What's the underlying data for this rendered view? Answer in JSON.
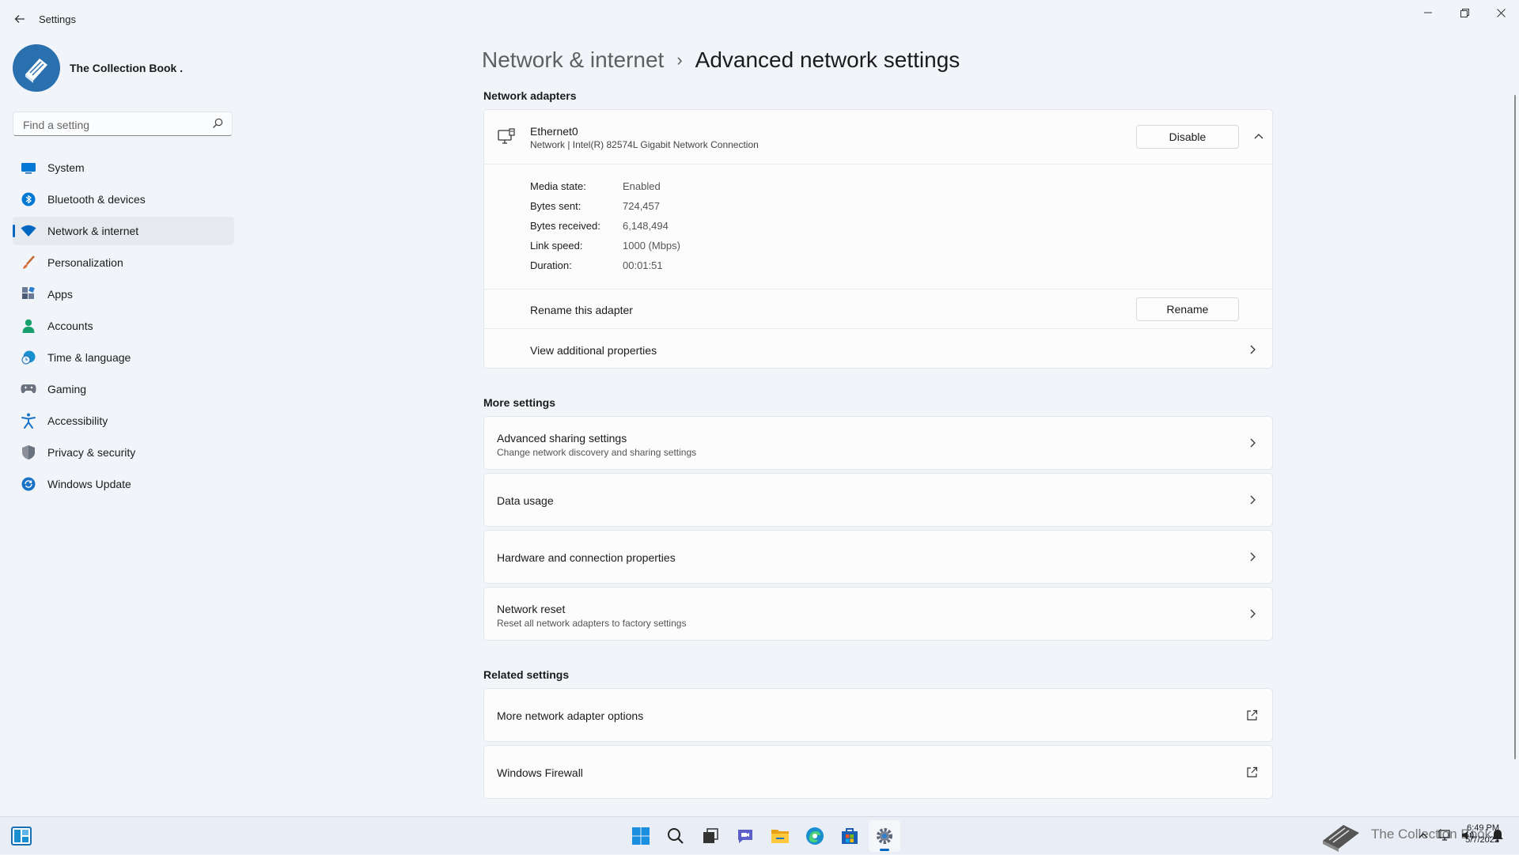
{
  "window": {
    "title": "Settings",
    "controls": {
      "minimize": "—",
      "maximize": "□",
      "close": "✕"
    }
  },
  "profile": {
    "name": "The Collection Book ."
  },
  "search": {
    "placeholder": "Find a setting",
    "icon": "search-icon"
  },
  "sidebar": {
    "items": [
      {
        "label": "System",
        "icon": "system-icon",
        "color": "#0078d4"
      },
      {
        "label": "Bluetooth & devices",
        "icon": "bluetooth-icon",
        "color": "#0078d4"
      },
      {
        "label": "Network & internet",
        "icon": "wifi-icon",
        "color": "#0067c0",
        "active": true
      },
      {
        "label": "Personalization",
        "icon": "brush-icon",
        "color": "#e0703a"
      },
      {
        "label": "Apps",
        "icon": "apps-icon",
        "color": "#4a5b78"
      },
      {
        "label": "Accounts",
        "icon": "person-icon",
        "color": "#1aa06d"
      },
      {
        "label": "Time & language",
        "icon": "globe-clock-icon",
        "color": "#1a8fd0"
      },
      {
        "label": "Gaming",
        "icon": "gamepad-icon",
        "color": "#6b7280"
      },
      {
        "label": "Accessibility",
        "icon": "accessibility-icon",
        "color": "#1a73c4"
      },
      {
        "label": "Privacy & security",
        "icon": "shield-icon",
        "color": "#6b7280"
      },
      {
        "label": "Windows Update",
        "icon": "update-icon",
        "color": "#1a73c4"
      }
    ]
  },
  "breadcrumb": {
    "parent": "Network & internet",
    "separator": "›",
    "current": "Advanced network settings"
  },
  "sections": {
    "adapters": "Network adapters",
    "more": "More settings",
    "related": "Related settings"
  },
  "adapter": {
    "name": "Ethernet0",
    "description": "Network | Intel(R) 82574L Gigabit Network Connection",
    "disable_label": "Disable",
    "properties": [
      {
        "label": "Media state:",
        "value": "Enabled"
      },
      {
        "label": "Bytes sent:",
        "value": "724,457"
      },
      {
        "label": "Bytes received:",
        "value": "6,148,494"
      },
      {
        "label": "Link speed:",
        "value": "1000 (Mbps)"
      },
      {
        "label": "Duration:",
        "value": "00:01:51"
      }
    ],
    "rename_text": "Rename this adapter",
    "rename_label": "Rename",
    "view_properties": "View additional properties"
  },
  "more_settings": [
    {
      "title": "Advanced sharing settings",
      "subtitle": "Change network discovery and sharing settings"
    },
    {
      "title": "Data usage"
    },
    {
      "title": "Hardware and connection properties"
    },
    {
      "title": "Network reset",
      "subtitle": "Reset all network adapters to factory settings"
    }
  ],
  "related_settings": [
    {
      "title": "More network adapter options"
    },
    {
      "title": "Windows Firewall"
    }
  ],
  "taskbar": {
    "apps": [
      "start-icon",
      "search-icon",
      "task-view-icon",
      "chat-icon",
      "file-explorer-icon",
      "edge-icon",
      "store-icon",
      "settings-icon"
    ],
    "active_app": "settings-icon",
    "tray_brand": "The Collection Book",
    "time": "6:49 PM",
    "date": "5/7/2022"
  },
  "colors": {
    "accent": "#0067c0",
    "background": "#f1f4f9",
    "card": "#fcfcfd"
  }
}
